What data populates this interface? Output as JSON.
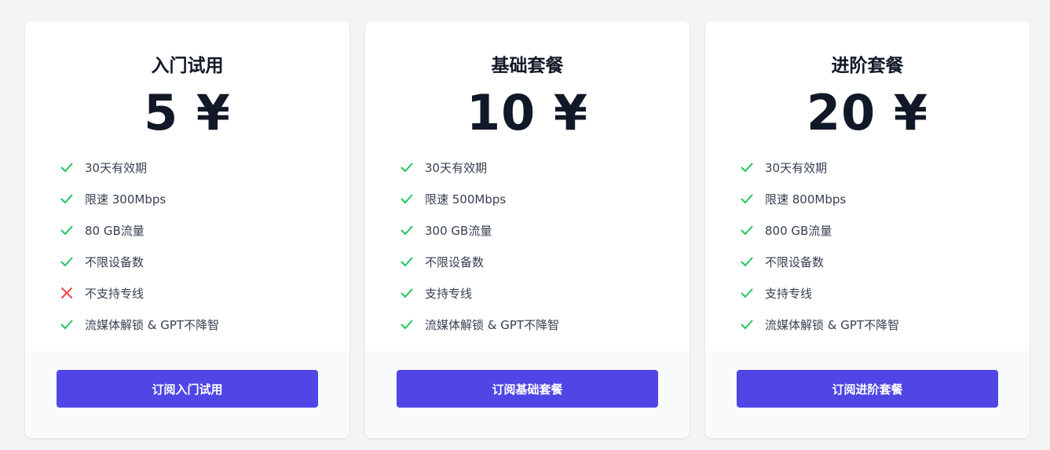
{
  "colors": {
    "accent": "#4f46e5",
    "check": "#22c55e",
    "cross": "#ef4444",
    "background": "#f3f4f6"
  },
  "plans": [
    {
      "name": "入门试用",
      "price": "5 ¥",
      "button_label": "订阅入门试用",
      "features": [
        {
          "text": "30天有效期",
          "icon": "check-icon"
        },
        {
          "text": "限速 300Mbps",
          "icon": "check-icon"
        },
        {
          "text": "80 GB流量",
          "icon": "check-icon"
        },
        {
          "text": "不限设备数",
          "icon": "check-icon"
        },
        {
          "text": "不支持专线",
          "icon": "cross-icon"
        },
        {
          "text": "流媒体解锁 & GPT不降智",
          "icon": "check-icon"
        }
      ]
    },
    {
      "name": "基础套餐",
      "price": "10 ¥",
      "button_label": "订阅基础套餐",
      "features": [
        {
          "text": "30天有效期",
          "icon": "check-icon"
        },
        {
          "text": "限速 500Mbps",
          "icon": "check-icon"
        },
        {
          "text": "300 GB流量",
          "icon": "check-icon"
        },
        {
          "text": "不限设备数",
          "icon": "check-icon"
        },
        {
          "text": "支持专线",
          "icon": "check-icon"
        },
        {
          "text": "流媒体解锁 & GPT不降智",
          "icon": "check-icon"
        }
      ]
    },
    {
      "name": "进阶套餐",
      "price": "20 ¥",
      "button_label": "订阅进阶套餐",
      "features": [
        {
          "text": "30天有效期",
          "icon": "check-icon"
        },
        {
          "text": "限速 800Mbps",
          "icon": "check-icon"
        },
        {
          "text": "800 GB流量",
          "icon": "check-icon"
        },
        {
          "text": "不限设备数",
          "icon": "check-icon"
        },
        {
          "text": "支持专线",
          "icon": "check-icon"
        },
        {
          "text": "流媒体解锁 & GPT不降智",
          "icon": "check-icon"
        }
      ]
    }
  ]
}
